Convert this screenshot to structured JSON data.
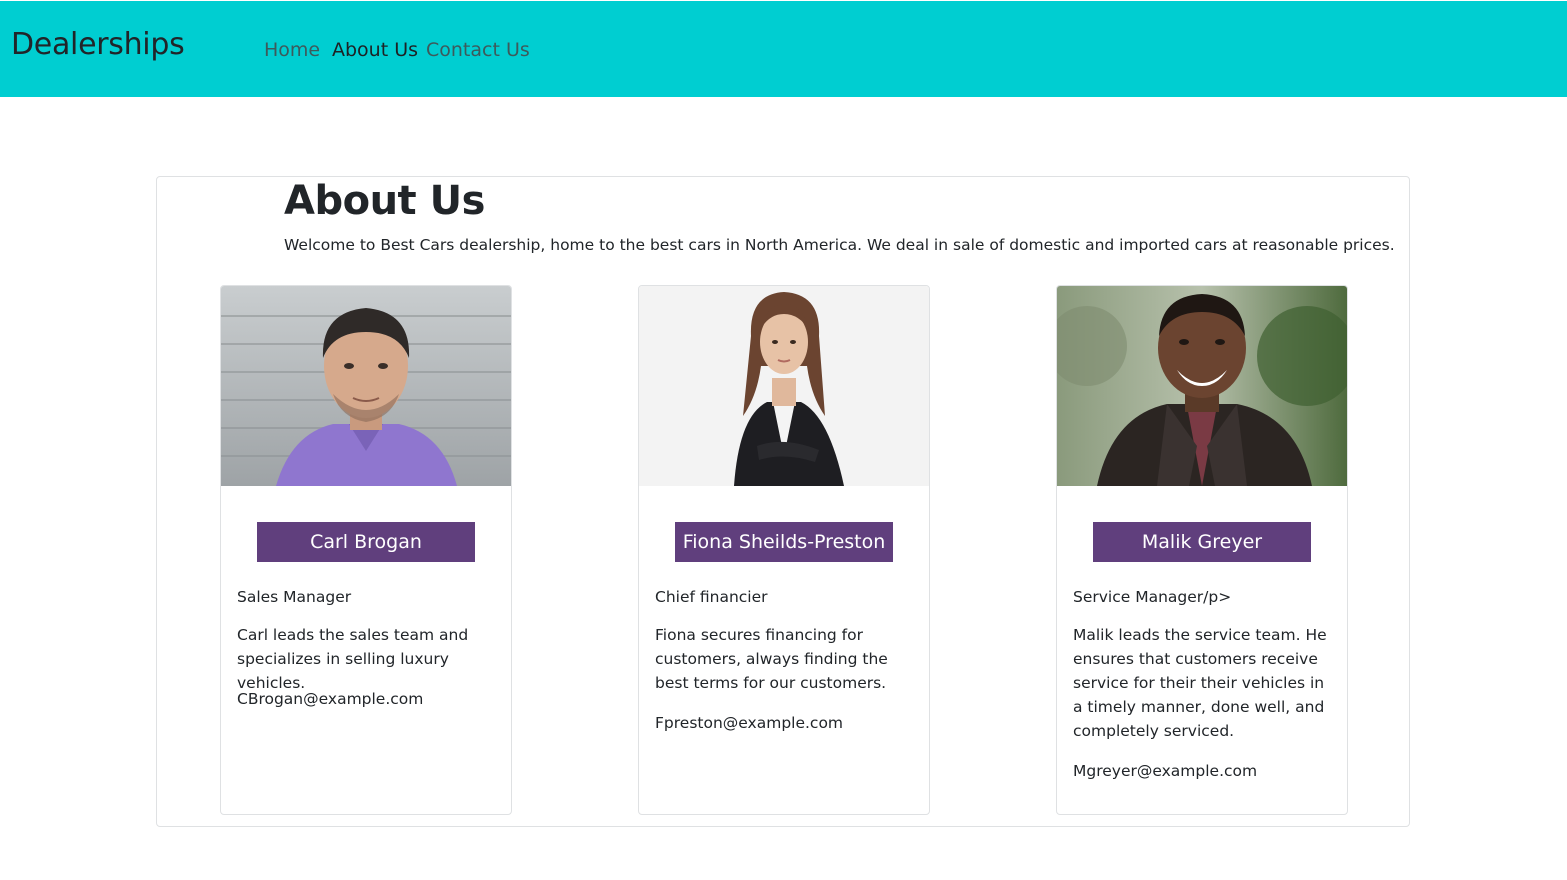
{
  "nav": {
    "brand": "Dealerships",
    "links": [
      "Home",
      "About Us",
      "Contact Us"
    ],
    "active": "About Us",
    "bg_color": "#00ced1"
  },
  "about": {
    "title": "About Us",
    "intro": "Welcome to Best Cars dealership, home to the best cars in North America. We deal in sale of domestic and imported cars at reasonable prices."
  },
  "team": [
    {
      "name": "Carl Brogan",
      "role": "Sales Manager",
      "description": "Carl leads the sales team and specializes in selling luxury vehicles.",
      "email": "CBrogan@example.com",
      "photo": "photo-man-purple-shirt"
    },
    {
      "name": "Fiona Sheilds-Preston",
      "role": "Chief financier",
      "description": "Fiona secures financing for customers, always finding the best terms for our customers.",
      "email": "Fpreston@example.com",
      "photo": "photo-woman-black-blazer"
    },
    {
      "name": "Malik Greyer",
      "role": "Service Manager/p>",
      "description": "Malik leads the service team. He ensures that customers receive service for their their vehicles in a timely manner, done well, and completely serviced.",
      "email": "Mgreyer@example.com",
      "photo": "photo-man-leather-jacket"
    }
  ],
  "colors": {
    "name_badge": "#603f7d",
    "card_border": "#dfe1e3"
  }
}
